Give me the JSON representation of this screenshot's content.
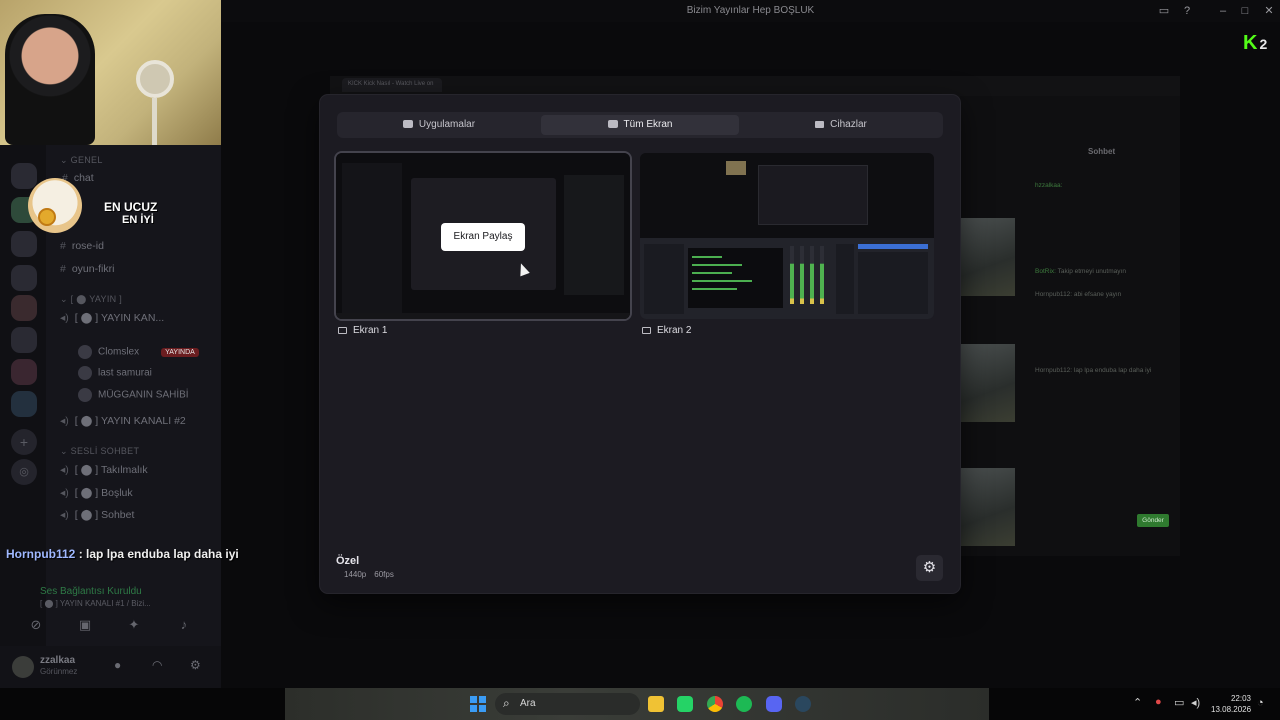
{
  "window": {
    "title": "Bizim Yayınlar Hep BOŞLUK"
  },
  "overlay_chat": {
    "username": "Hornpub112",
    "message": " : lap lpa enduba lap daha iyi"
  },
  "sticker": {
    "line1": "EN UCUZ",
    "line2": "EN İYİ"
  },
  "discord": {
    "categories": [
      "GENEL",
      "YAYIN",
      "SESLİ SOHBET"
    ],
    "channels": [
      {
        "label": "chat",
        "type": "text"
      },
      {
        "label": "rose-id",
        "type": "text"
      },
      {
        "label": "oyun-fikri",
        "type": "text"
      },
      {
        "label": "YAYIN KAN...",
        "type": "voice"
      },
      {
        "label": "YAYIN KANALI #2",
        "type": "voice"
      },
      {
        "label": "Takılmalık",
        "type": "voice"
      },
      {
        "label": "Boşluk",
        "type": "voice"
      },
      {
        "label": "Sohbet",
        "type": "voice"
      }
    ],
    "stream_users": [
      {
        "name": "Clomslex",
        "badge": "YAYINDA"
      },
      {
        "name": "last samurai",
        "badge": ""
      },
      {
        "name": "MÜGGANIN SAHİBİ",
        "badge": ""
      }
    ],
    "voice_status": "Ses Bağlantısı Kuruldu",
    "voice_sub": "[ ⬤ ] YAYIN KANALI #1 / Bizi...",
    "user": {
      "name": "zzalkaa",
      "status": "Görünmez"
    }
  },
  "background_stream": {
    "tab_label": "KICK Kick Nasıl - Watch Live on",
    "chat_title": "Sohbet",
    "send_label": "Gönder",
    "chat_lines": [
      {
        "user": "hzzalkaa:",
        "text": ""
      },
      {
        "user": "BotRix:",
        "text": "Takip etmeyi unutmayın"
      },
      {
        "user": "Hornpub112:",
        "text": "abi efsane yayın"
      },
      {
        "user": "Hornpub112:",
        "text": "lap lpa enduba lap daha iyi"
      }
    ]
  },
  "kick_logo": {
    "letter": "K",
    "suffix": "2"
  },
  "modal": {
    "tabs": [
      {
        "label": "Uygulamalar",
        "icon": "window-icon",
        "active": false
      },
      {
        "label": "Tüm Ekran",
        "icon": "monitor-icon",
        "active": true
      },
      {
        "label": "Cihazlar",
        "icon": "camera-icon",
        "active": false
      }
    ],
    "screens": [
      {
        "label": "Ekran 1",
        "selected": true
      },
      {
        "label": "Ekran 2",
        "selected": false
      }
    ],
    "share_button": "Ekran Paylaş",
    "quality": {
      "title": "Özel",
      "resolution": "1440p",
      "framerate": "60fps"
    }
  },
  "taskbar": {
    "search_placeholder": "Ara",
    "apps": [
      "file-explorer",
      "whatsapp",
      "chrome",
      "spotify",
      "discord",
      "steam"
    ],
    "time": "22:03",
    "date": "13.08.2026"
  },
  "colors": {
    "modal_bg": "#1c1b22",
    "accent_green": "#53fc18",
    "windows_blue": "#3b9cf5"
  }
}
